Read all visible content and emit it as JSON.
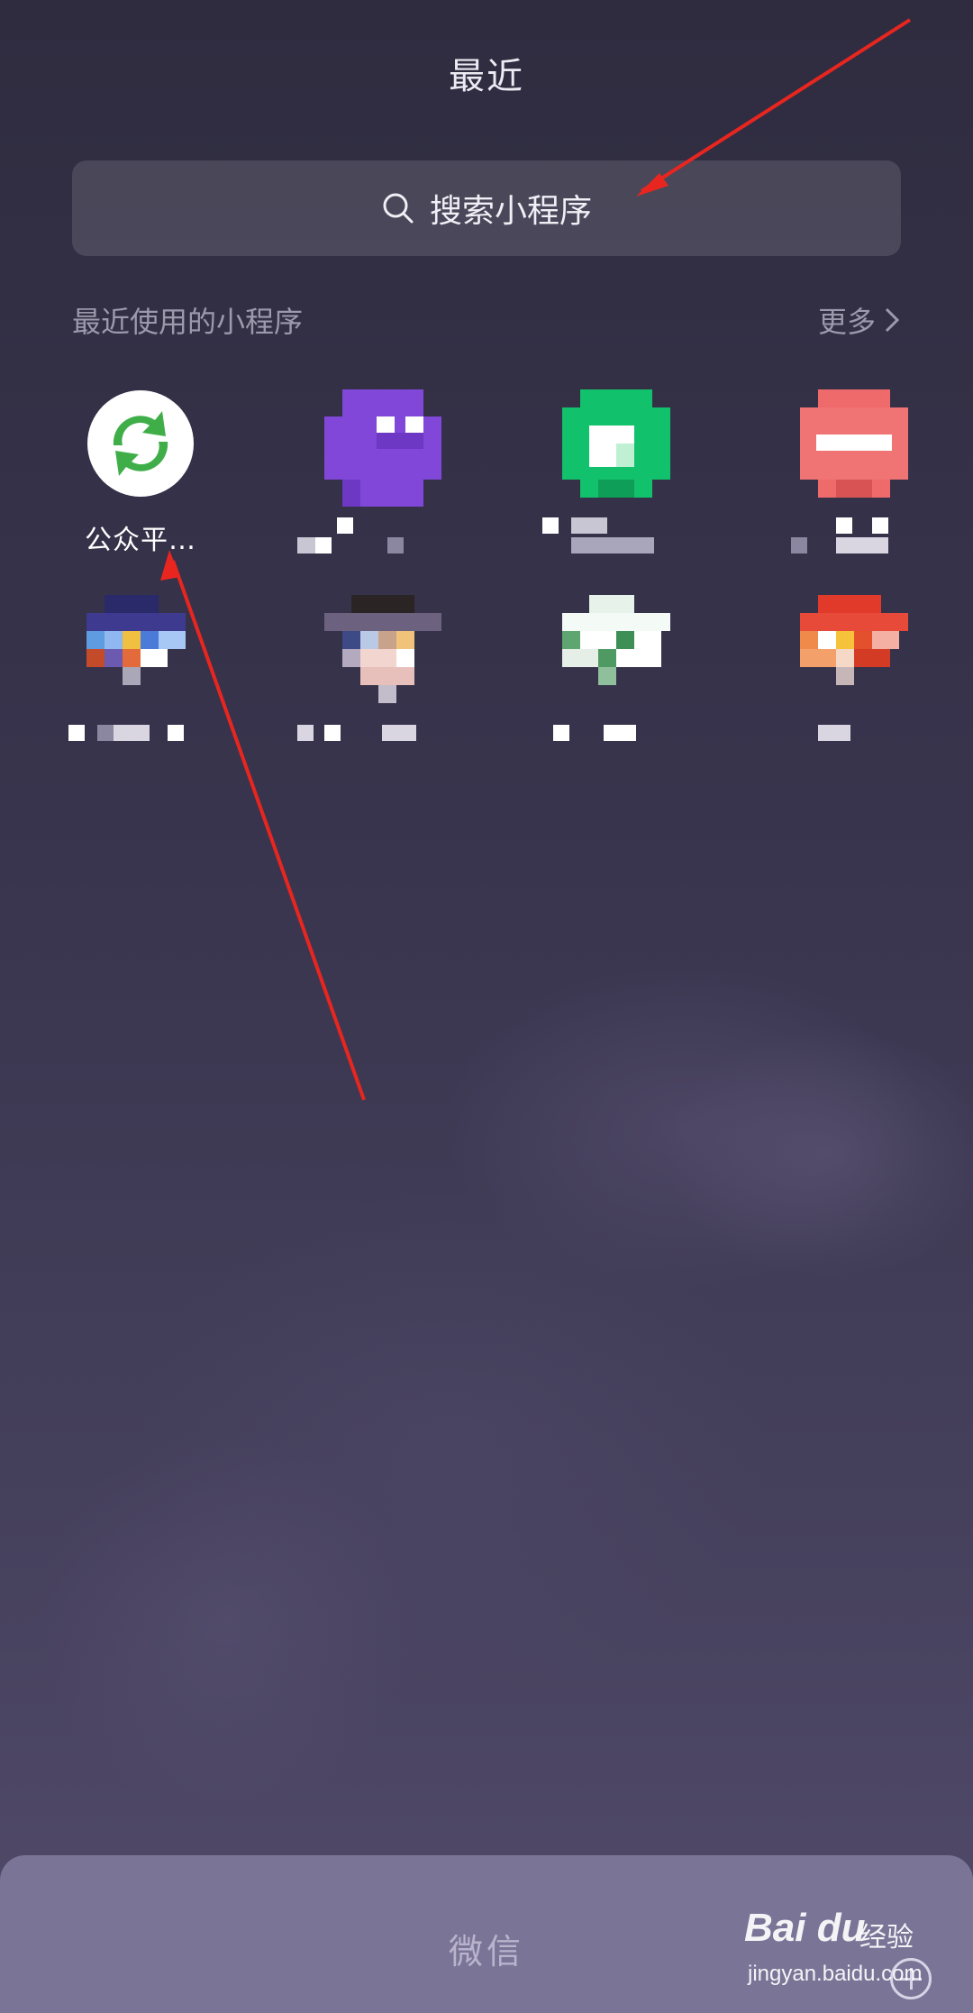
{
  "header": {
    "title": "最近"
  },
  "search": {
    "placeholder": "搜索小程序",
    "icon": "search-icon"
  },
  "recent_section": {
    "title": "最近使用的小程序",
    "more_label": "更多"
  },
  "apps": [
    {
      "label": "公众平…",
      "icon": "green-swirl-icon"
    },
    {
      "label": "",
      "icon": "purple-pixelated-icon"
    },
    {
      "label": "",
      "icon": "green-pixelated-icon"
    },
    {
      "label": "",
      "icon": "red-pixelated-icon"
    },
    {
      "label": "",
      "icon": "blue-pixelated-icon"
    },
    {
      "label": "",
      "icon": "portrait-pixelated-icon"
    },
    {
      "label": "",
      "icon": "white-green-pixelated-icon"
    },
    {
      "label": "",
      "icon": "orange-pixelated-icon"
    }
  ],
  "dock": {
    "label": "微信"
  },
  "watermark": {
    "logo": "Bai du",
    "text": "经验",
    "domain": "jingyan.baidu.com"
  },
  "annotation": {
    "color": "#e8261f"
  }
}
